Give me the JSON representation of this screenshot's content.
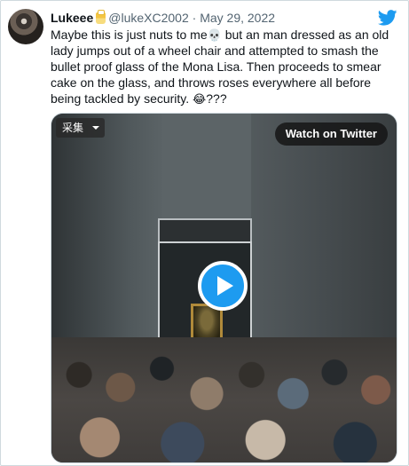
{
  "tweet": {
    "author_name": "Lukeee",
    "handle": "@lukeXC2002",
    "separator": "·",
    "date": "May 29, 2022",
    "text_part1": "Maybe this is just nuts to me",
    "emoji_skull": "💀",
    "text_part2": " but an man dressed as an old lady jumps out of a wheel chair and attempted to smash the bullet proof glass of the Mona Lisa. Then proceeds to smear cake on the glass, and throws roses everywhere all before being tackled by security. ",
    "emoji_laugh": "😂",
    "text_part3": "???"
  },
  "media": {
    "quality_label": "采集",
    "watch_label": "Watch on Twitter"
  },
  "colors": {
    "twitter_blue": "#1d9bf0",
    "text_primary": "#0f1419",
    "text_secondary": "#536471"
  },
  "icons": [
    "avatar",
    "badge-icon",
    "twitter-bird-icon",
    "play-icon",
    "chevron-down-icon"
  ]
}
